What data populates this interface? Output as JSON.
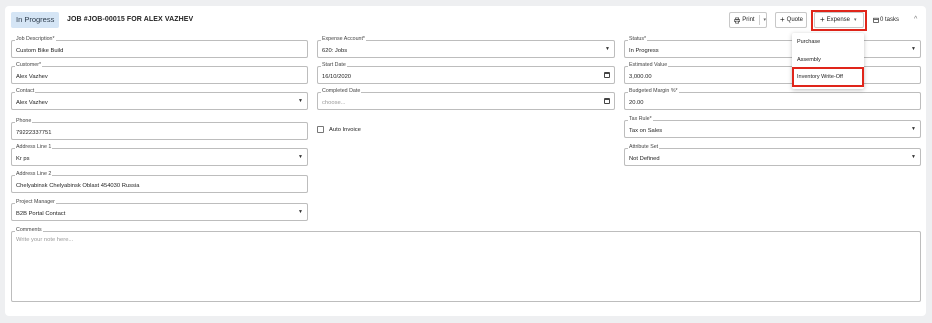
{
  "header": {
    "status_badge": "In Progress",
    "job_title": "JOB #JOB-00015 FOR ALEX VAZHEV",
    "print_label": "Print",
    "quote_label": "Quote",
    "expense_label": "Expense",
    "tasks_label": "0 tasks"
  },
  "expense_menu": {
    "items": [
      "Purchase",
      "Assembly",
      "Inventory Write-Off"
    ]
  },
  "form": {
    "job_description": {
      "label": "Job Description*",
      "value": "Custom Bike Build"
    },
    "customer": {
      "label": "Customer*",
      "value": "Alex Vazhev"
    },
    "contact": {
      "label": "Contact",
      "value": "Alex Vazhev"
    },
    "phone": {
      "label": "Phone",
      "value": "79222337751"
    },
    "address1": {
      "label": "Address Line 1",
      "value": "Kr ps"
    },
    "address2": {
      "label": "Address Line 2",
      "value": "Chelyabinsk Chelyabinsk Oblast 454030 Russia"
    },
    "project_manager": {
      "label": "Project Manager",
      "value": "B2B Portal Contact"
    },
    "expense_account": {
      "label": "Expense Account*",
      "value": "620: Jobs"
    },
    "start_date": {
      "label": "Start Date",
      "value": "16/10/2020"
    },
    "completed_date": {
      "label": "Completed Date",
      "placeholder": "choose..."
    },
    "auto_invoice": {
      "label": "Auto Invoice"
    },
    "status": {
      "label": "Status*",
      "value": "In Progress"
    },
    "estimated_value": {
      "label": "Estimated Value",
      "value": "3,000.00"
    },
    "budgeted_margin": {
      "label": "Budgeted Margin %*",
      "value": "20.00"
    },
    "tax_rule": {
      "label": "Tax Rule*",
      "value": "Tax on Sales"
    },
    "attribute_set": {
      "label": "Attribute Set",
      "value": "Not Defined"
    },
    "comments": {
      "label": "Comments",
      "placeholder": "Write your note here..."
    }
  },
  "colors": {
    "highlight": "#e0251a",
    "badge_bg": "#d5e5f5"
  }
}
